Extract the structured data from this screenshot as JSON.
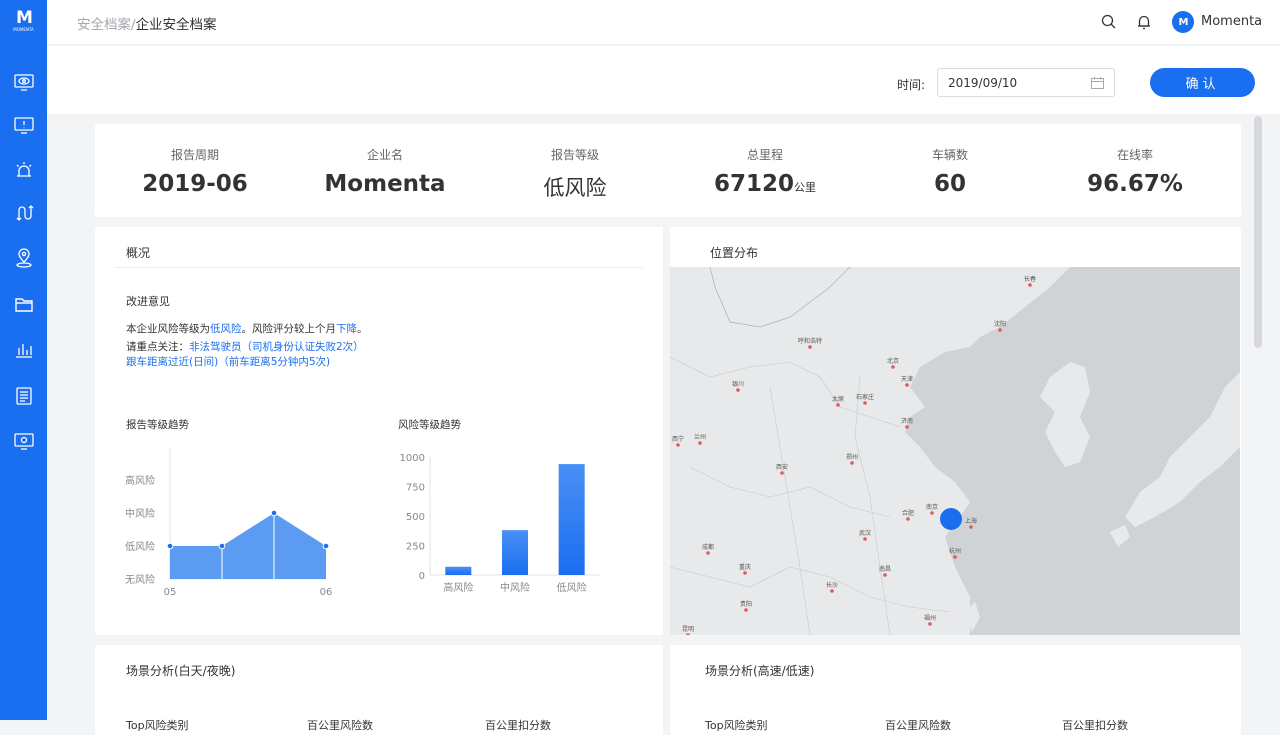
{
  "sidebar": {
    "logo_mark": "M",
    "logo_text": "MOMENTA",
    "icons": [
      "eye-monitor-icon",
      "alert-screen-icon",
      "alarm-light-icon",
      "route-icon",
      "location-pin-icon",
      "folder-icon",
      "bar-chart-icon",
      "document-list-icon",
      "display-monitor-icon"
    ],
    "active_index": 5
  },
  "header": {
    "breadcrumb_root": "安全档案",
    "breadcrumb_sep": "/",
    "breadcrumb_current": "企业安全档案",
    "avatar_initials": "M",
    "username": "Momenta"
  },
  "filter": {
    "time_label": "时间:",
    "date_value": "2019/09/10",
    "confirm_label": "确认"
  },
  "summary": [
    {
      "label": "报告周期",
      "value": "2019-06",
      "unit": ""
    },
    {
      "label": "企业名",
      "value": "Momenta",
      "unit": ""
    },
    {
      "label": "报告等级",
      "value": "低风险",
      "unit": ""
    },
    {
      "label": "总里程",
      "value": "67120",
      "unit": "公里"
    },
    {
      "label": "车辆数",
      "value": "60",
      "unit": ""
    },
    {
      "label": "在线率",
      "value": "96.67%",
      "unit": ""
    }
  ],
  "overview": {
    "title": "概况",
    "advice_title": "改进意见",
    "line1_a": "本企业风险等级为",
    "line1_b": "低风险",
    "line1_c": "。风险评分较上个月",
    "line1_d": "下降",
    "line1_e": "。",
    "line2_a": "请重点关注：",
    "line2_b": "非法驾驶员（司机身份认证失败2次）",
    "line3": "跟车距离过近(日间)（前车距离5分钟内5次)"
  },
  "chart_data": [
    {
      "type": "area",
      "title": "报告等级趋势",
      "y_categories": [
        "无风险",
        "低风险",
        "中风险",
        "高风险"
      ],
      "x_tick_labels": [
        "05",
        "06"
      ],
      "values": [
        1,
        1,
        2,
        1
      ],
      "color": "#5b9cf2"
    },
    {
      "type": "bar",
      "title": "风险等级趋势",
      "categories": [
        "高风险",
        "中风险",
        "低风险"
      ],
      "values": [
        70,
        380,
        940
      ],
      "ylim": [
        0,
        1000
      ],
      "yticks": [
        0,
        250,
        500,
        750,
        1000
      ],
      "color": "#1a6ef0"
    }
  ],
  "map": {
    "title": "位置分布",
    "cities": [
      "长春",
      "沈阳",
      "呼和浩特",
      "北京",
      "天津",
      "银川",
      "太原",
      "石家庄",
      "济南",
      "兰州",
      "西宁",
      "郑州",
      "西安",
      "合肥",
      "南京",
      "上海",
      "武汉",
      "成都",
      "杭州",
      "重庆",
      "长沙",
      "南昌",
      "贵阳",
      "福州",
      "昆明"
    ]
  },
  "bottom": {
    "left_title": "场景分析(白天/夜晚)",
    "right_title": "场景分析(高速/低速)",
    "col1": "Top风险类别",
    "col2": "百公里风险数",
    "col3": "百公里扣分数"
  },
  "colors": {
    "primary": "#1a6ef0"
  }
}
